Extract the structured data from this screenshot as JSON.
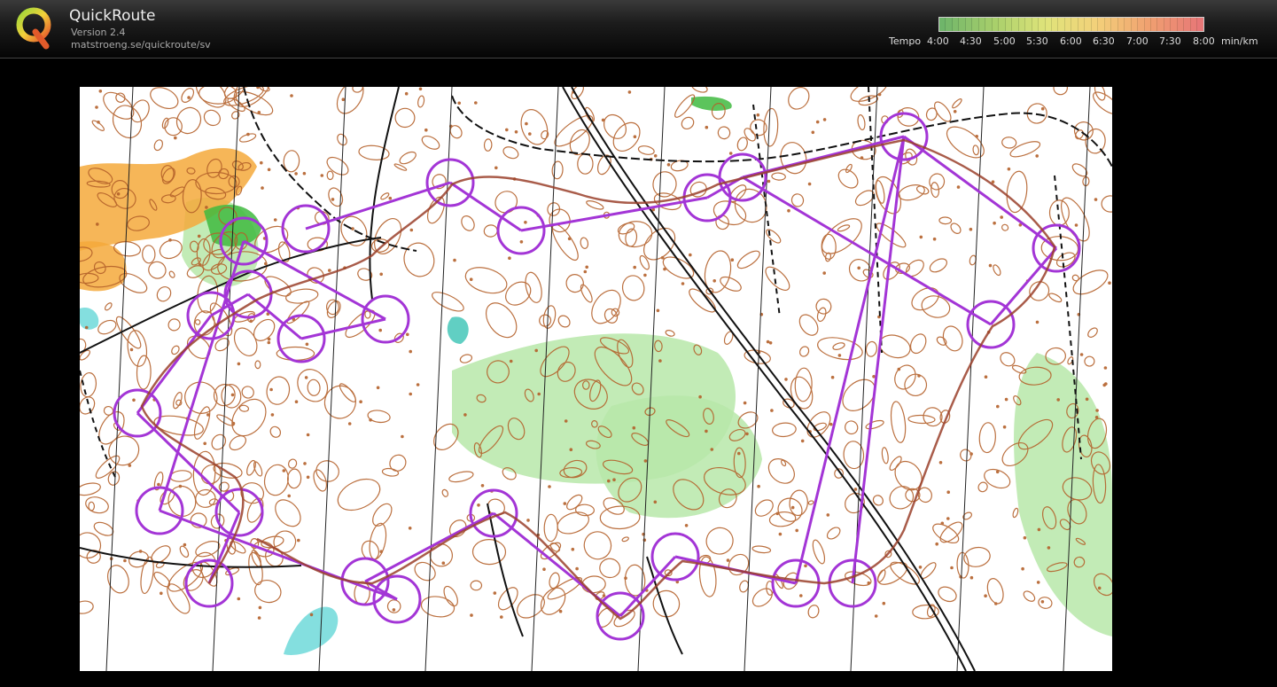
{
  "app": {
    "title": "QuickRoute",
    "version": "Version 2.4",
    "url": "matstroeng.se/quickroute/sv",
    "logo_letter": "Q"
  },
  "legend": {
    "label": "Tempo",
    "ticks": [
      "4:00",
      "4:30",
      "5:00",
      "5:30",
      "6:00",
      "6:30",
      "7:00",
      "7:30",
      "8:00"
    ],
    "unit": "min/km",
    "gradient_colors": [
      "#6fb56a",
      "#a8cf6b",
      "#dfe47a",
      "#f3d07a",
      "#f0a070",
      "#e77777"
    ]
  },
  "map": {
    "icon": "orienteering-map",
    "colors": {
      "contour": "#b4602a",
      "course": "#a335d6",
      "route": "#9a3f2a",
      "water": "#6fd9d9",
      "marsh": "#45c7b9",
      "green": "#3fba3f",
      "light_green": "#b7e7a9",
      "yellow": "#f5a93b",
      "black": "#111111"
    }
  }
}
